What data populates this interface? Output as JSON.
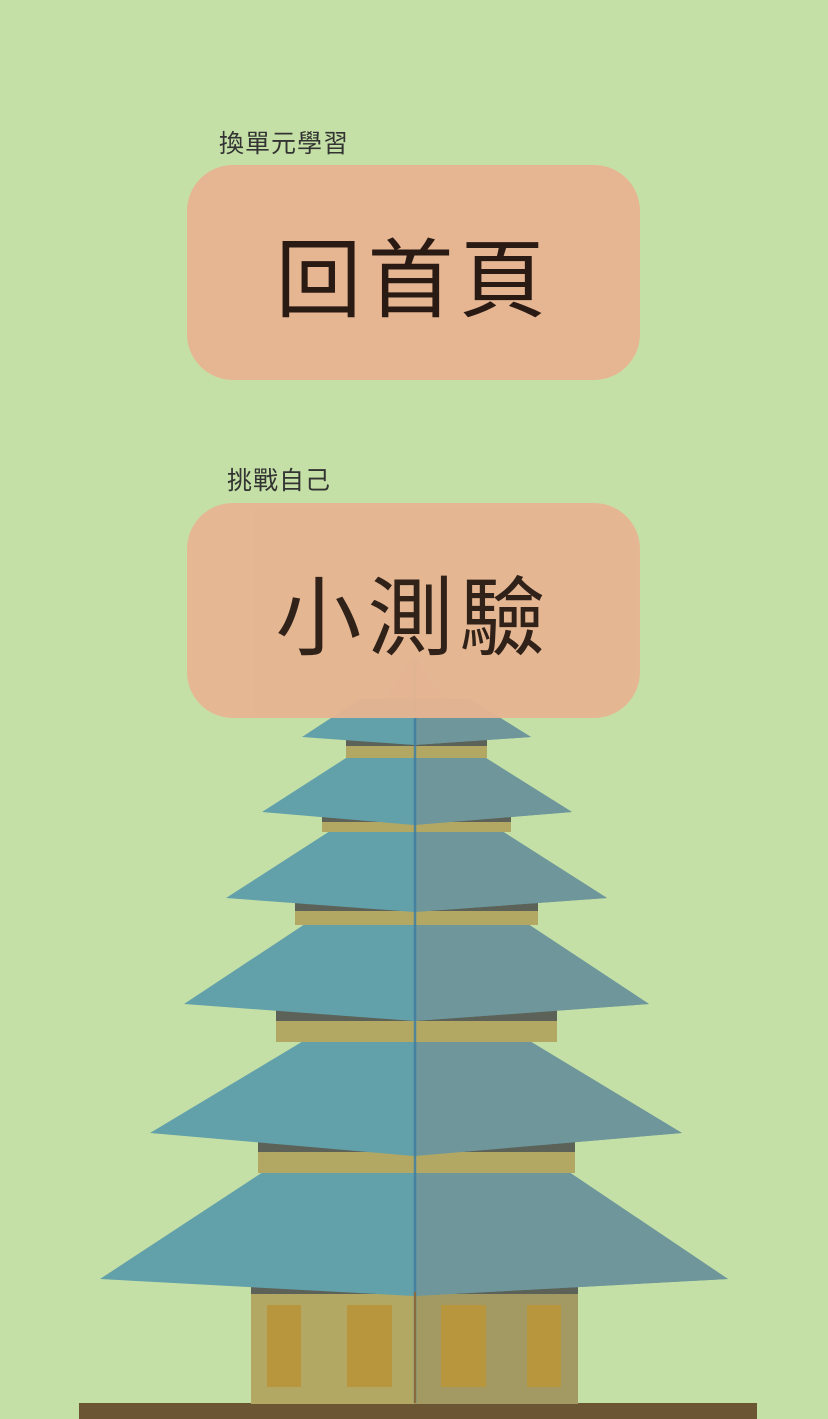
{
  "menu": {
    "home": {
      "caption": "換單元學習",
      "label": "回首頁"
    },
    "quiz": {
      "caption": "挑戰自己",
      "label": "小測驗"
    }
  },
  "colors": {
    "background": "#c5e0a6",
    "button": "#e6b592",
    "roof": "#5f9ea8",
    "body": "#b2a864",
    "window": "#b8963e",
    "ground": "#6b5532"
  },
  "illustration": {
    "name": "pagoda-illustration"
  }
}
